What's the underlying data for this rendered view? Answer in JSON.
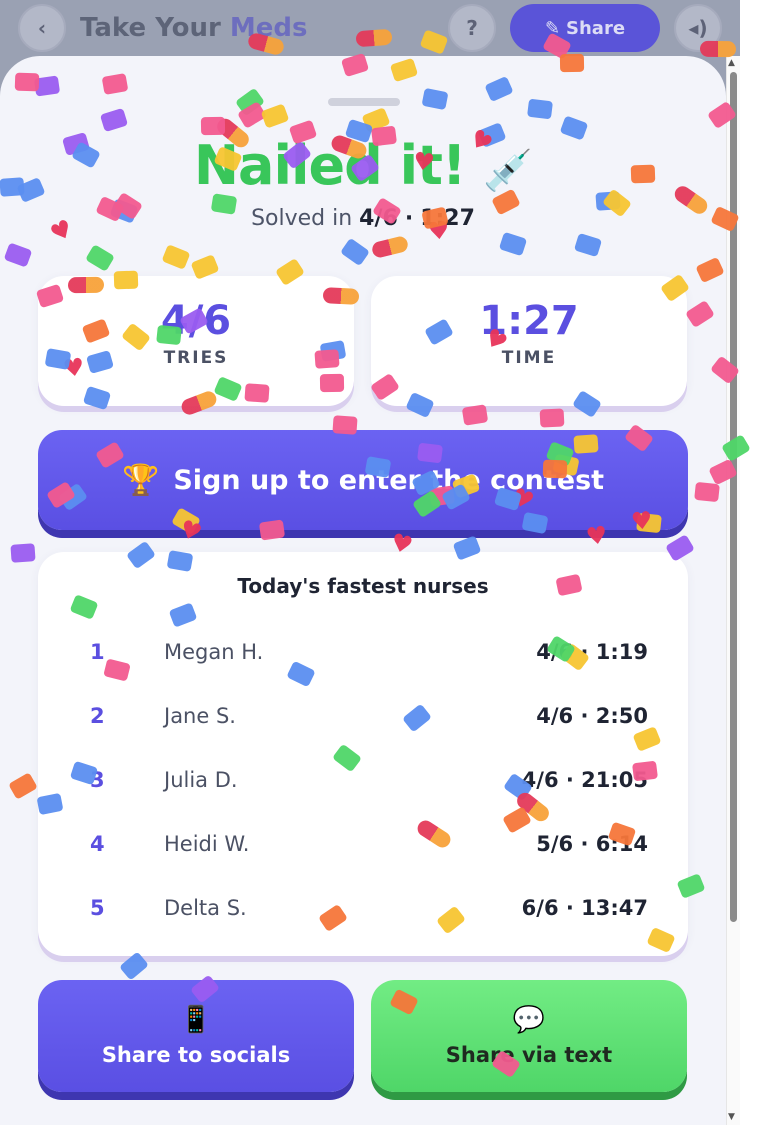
{
  "background_header": {
    "back_icon": "chevron-left",
    "title_main": "Take Your",
    "title_accent": "Meds",
    "help_label": "?",
    "share_label": "Share",
    "share_icon": "pencil-icon",
    "sound_icon": "speaker-icon"
  },
  "result": {
    "headline": "Nailed it!",
    "headline_emoji": "💉",
    "subline_prefix": "Solved in",
    "subline_tries": "4/6",
    "subline_sep": "·",
    "subline_time": "1:27"
  },
  "stats": [
    {
      "value": "4/6",
      "label": "TRIES"
    },
    {
      "value": "1:27",
      "label": "TIME"
    }
  ],
  "contest_button": {
    "icon": "🏆",
    "label": "Sign up to enter the contest"
  },
  "leaderboard": {
    "title": "Today's fastest nurses",
    "rows": [
      {
        "rank": "1",
        "name": "Megan H.",
        "score": "4/6 · 1:19"
      },
      {
        "rank": "2",
        "name": "Jane S.",
        "score": "4/6 · 2:50"
      },
      {
        "rank": "3",
        "name": "Julia D.",
        "score": "4/6 · 21:05"
      },
      {
        "rank": "4",
        "name": "Heidi W.",
        "score": "5/6 · 6:14"
      },
      {
        "rank": "5",
        "name": "Delta S.",
        "score": "6/6 · 13:47"
      }
    ]
  },
  "share_buttons": {
    "socials": {
      "icon": "📱",
      "label": "Share to socials"
    },
    "text": {
      "icon": "💬",
      "label": "Share via text"
    }
  },
  "colors": {
    "accent_purple": "#5b4fe0",
    "success_green": "#39c65a",
    "text_dark": "#1f2433"
  }
}
